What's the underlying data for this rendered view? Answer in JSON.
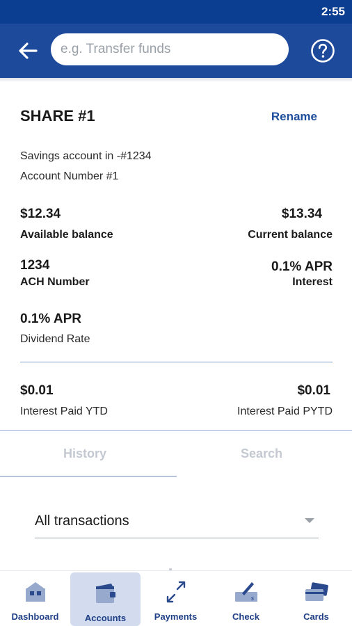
{
  "status_bar": {
    "time": "2:55"
  },
  "app_bar": {
    "search_placeholder": "e.g. Transfer funds",
    "back_icon": "arrow-left-icon",
    "help_icon": "question-circle-icon"
  },
  "account": {
    "title": "SHARE #1",
    "rename_label": "Rename",
    "description": "Savings account in -#1234",
    "account_number_text": "Account Number #1",
    "available_balance": {
      "value": "$12.34",
      "label": "Available balance"
    },
    "current_balance": {
      "value": "$13.34",
      "label": "Current balance"
    },
    "ach": {
      "value": "1234",
      "label": "ACH Number"
    },
    "interest": {
      "value": "0.1% APR",
      "label": "Interest"
    },
    "dividend": {
      "value": "0.1% APR",
      "label": "Dividend Rate"
    },
    "interest_paid_ytd": {
      "value": "$0.01",
      "label": "Interest Paid YTD"
    },
    "interest_paid_pytd": {
      "value": "$0.01",
      "label": "Interest Paid PYTD"
    }
  },
  "tabs": [
    {
      "label": "History",
      "selected": true
    },
    {
      "label": "Search",
      "selected": false
    }
  ],
  "filter": {
    "selected": "All transactions"
  },
  "bottom_nav": [
    {
      "label": "Dashboard",
      "icon": "building-icon",
      "active": false
    },
    {
      "label": "Accounts",
      "icon": "wallet-icon",
      "active": true
    },
    {
      "label": "Payments",
      "icon": "transfer-arrows-icon",
      "active": false
    },
    {
      "label": "Check",
      "icon": "check-pen-icon",
      "active": false
    },
    {
      "label": "Cards",
      "icon": "credit-cards-icon",
      "active": false
    }
  ],
  "colors": {
    "primary": "#1e4a9c",
    "status_bar": "#0b3e91",
    "link": "#1f4e9c",
    "active_nav_bg": "#d3dcee"
  }
}
